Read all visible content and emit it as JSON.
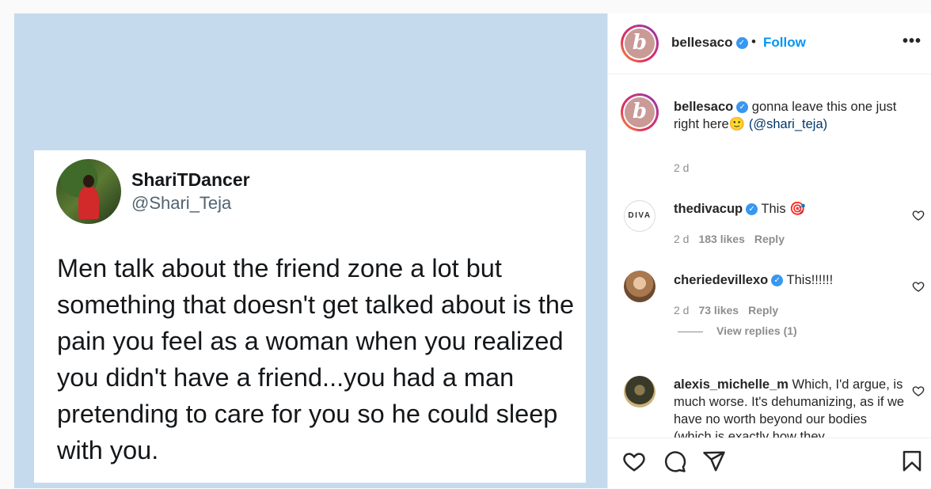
{
  "tweet": {
    "name": "ShariTDancer",
    "handle": "@Shari_Teja",
    "text": "Men talk about the friend zone a lot but something that doesn't get talked about is the pain you feel as a woman when you realized you didn't have a friend...you had a man pretending to care for you so he could sleep with you."
  },
  "header": {
    "username": "bellesaco",
    "separator": "•",
    "follow_label": "Follow",
    "more_label": "•••",
    "avatar_letter": "b"
  },
  "caption": {
    "username": "bellesaco",
    "text": " gonna leave this one just right here🙂 ",
    "mention": "(@shari_teja)",
    "time": "2 d"
  },
  "comments": [
    {
      "username": "thedivacup",
      "text": " This 🎯",
      "time": "2 d",
      "likes": "183 likes",
      "reply": "Reply",
      "avatar_text": "DIVA"
    },
    {
      "username": "cheriedevillexo",
      "text": " This!!!!!!",
      "time": "2 d",
      "likes": "73 likes",
      "reply": "Reply"
    },
    {
      "username": "alexis_michelle_m",
      "text": " Which, I'd argue, is much worse. It's dehumanizing, as if we have no worth beyond our bodies (which is exactly how they"
    }
  ],
  "view_replies": "View replies (1)",
  "colors": {
    "accent": "#0095f6",
    "verified": "#3897f0",
    "image_bg": "#c5daec"
  },
  "icons": [
    "heart-icon",
    "comment-icon",
    "share-icon",
    "bookmark-icon",
    "more-icon",
    "verified-icon"
  ]
}
